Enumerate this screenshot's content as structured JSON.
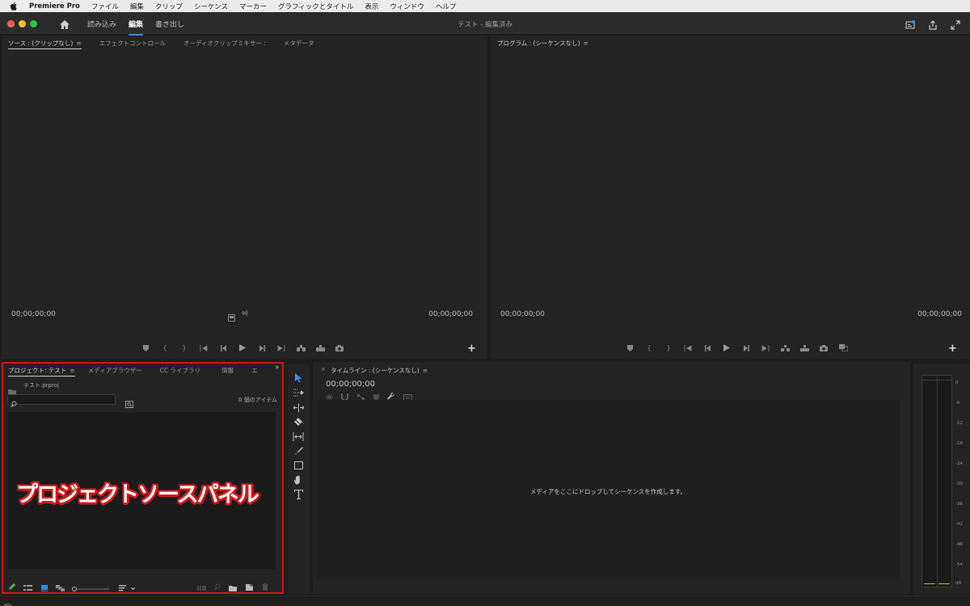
{
  "menubar": {
    "items": [
      "Premiere Pro",
      "ファイル",
      "編集",
      "クリップ",
      "シーケンス",
      "マーカー",
      "グラフィックとタイトル",
      "表示",
      "ウィンドウ",
      "ヘルプ"
    ]
  },
  "header": {
    "workspace_tabs": [
      "読み込み",
      "編集",
      "書き出し"
    ],
    "active_tab": "編集",
    "doc_title": "テスト - 編集済み"
  },
  "source_monitor": {
    "tabs": [
      "ソース : (クリップなし)",
      "エフェクトコントロール",
      "オーディオクリップミキサー :",
      "メタデータ"
    ],
    "menu_icon": "≡",
    "timecode_left": "00;00;00;00",
    "timecode_right": "00;00;00;00"
  },
  "program_monitor": {
    "tabs": [
      "プログラム : (シーケンスなし)"
    ],
    "menu_icon": "≡",
    "timecode_left": "00;00;00;00",
    "timecode_right": "00;00;00;00"
  },
  "project_panel": {
    "tabs": [
      "プロジェクト: テスト",
      "メディアブラウザー",
      "CC ライブラリ",
      "情報",
      "エ"
    ],
    "menu_icon": "≡",
    "more_icon": "»",
    "file_name": "テスト.prproj",
    "item_count": "0 個のアイテム",
    "overlay_label": "プロジェクトソースパネル"
  },
  "timeline_panel": {
    "close_icon": "×",
    "tab": "タイムライン : (シーケンスなし)",
    "menu_icon": "≡",
    "timecode": "00;00;00;00",
    "drop_message": "メディアをここにドロップしてシーケンスを作成します。"
  },
  "audio_meter": {
    "scale": [
      "0",
      "-6",
      "-12",
      "-18",
      "-24",
      "-30",
      "-36",
      "-42",
      "-48",
      "-54",
      "dB"
    ]
  },
  "colors": {
    "accent_blue": "#2d8ceb",
    "highlight_red": "#d8141b"
  }
}
